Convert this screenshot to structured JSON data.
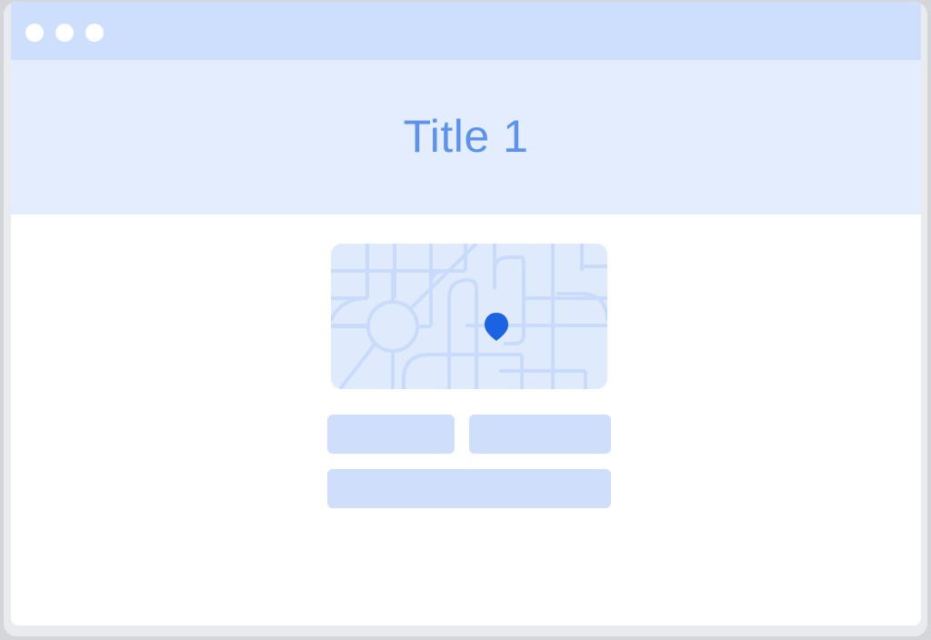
{
  "window": {
    "controls": [
      "window-dot",
      "window-dot",
      "window-dot"
    ]
  },
  "header": {
    "title": "Title 1"
  },
  "map": {
    "icon": "map-pin-icon",
    "pin_color": "#1a63e3"
  },
  "form": {
    "fields": [
      "",
      "",
      ""
    ]
  },
  "colors": {
    "titlebar": "#cddffc",
    "header_band": "#e4edfe",
    "title_text": "#5b93ee",
    "map_bg": "#e0eafd",
    "map_roads": "#c9dbfb",
    "placeholder": "#cfdefb"
  }
}
